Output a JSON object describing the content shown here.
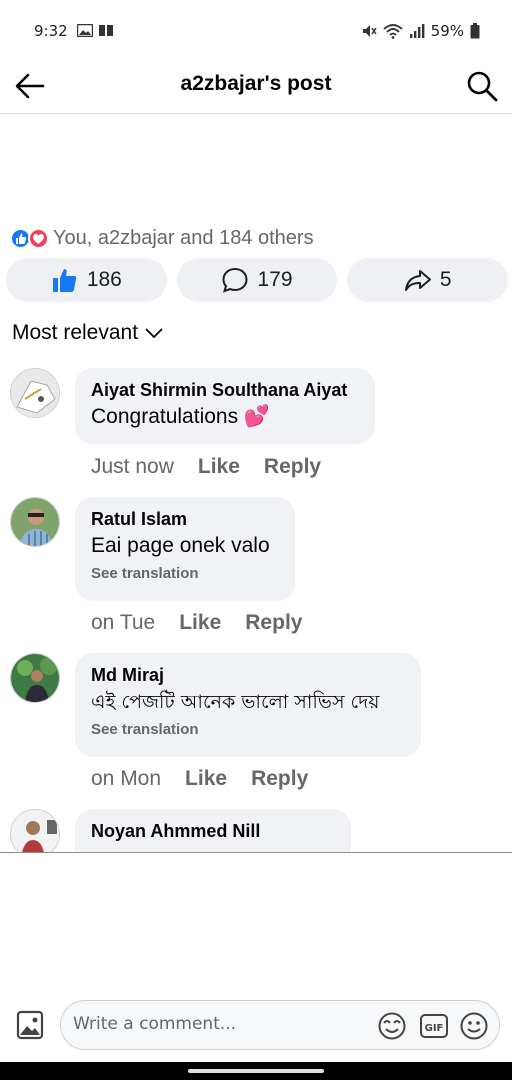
{
  "status_bar": {
    "time": "9:32",
    "battery": "59%"
  },
  "header": {
    "title": "a2zbajar's post"
  },
  "reactions": {
    "summary": "You, a2zbajar and 184 others"
  },
  "actions": {
    "likes": "186",
    "comments": "179",
    "shares": "5"
  },
  "sort": {
    "label": "Most relevant"
  },
  "comments": [
    {
      "name": "Aiyat Shirmin Soulthana Aiyat",
      "text": "Congratulations 💕",
      "time": "Just now",
      "like": "Like",
      "reply": "Reply"
    },
    {
      "name": "Ratul Islam",
      "text": "Eai page onek valo",
      "translation": "See translation",
      "time": "on Tue",
      "like": "Like",
      "reply": "Reply"
    },
    {
      "name": "Md Miraj",
      "text": "এই পেজটি আনেক ভালো সাভিস দেয়",
      "translation": "See translation",
      "time": "on Mon",
      "like": "Like",
      "reply": "Reply"
    },
    {
      "name": "Noyan Ahmmed Nill"
    }
  ],
  "composer": {
    "placeholder": "Write a comment..."
  }
}
